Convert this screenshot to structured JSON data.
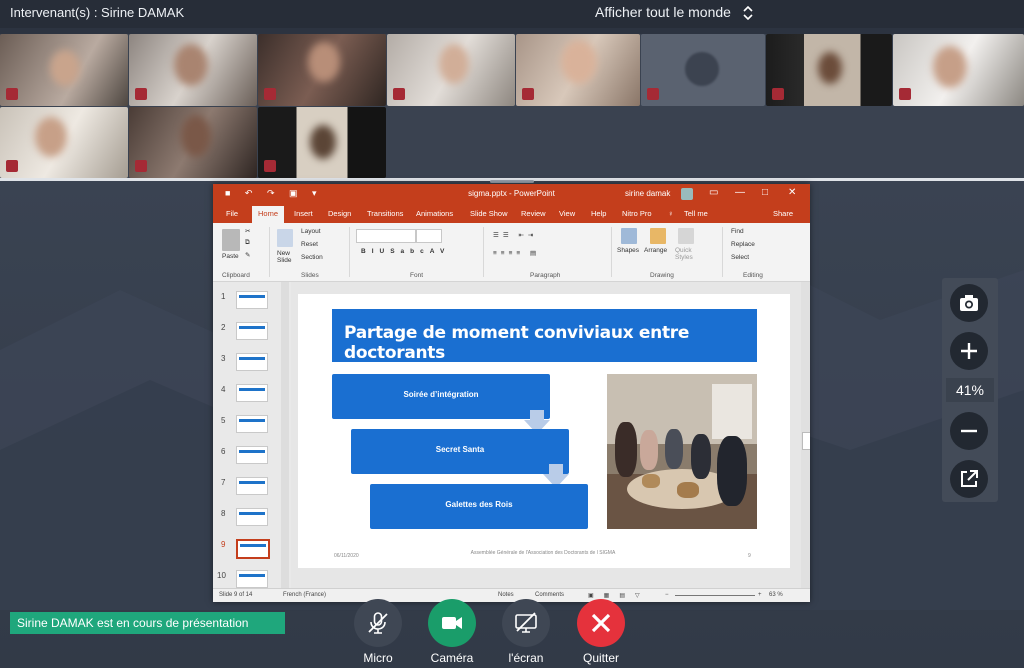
{
  "header": {
    "speaker": "Intervenant(s) : Sirine DAMAK",
    "show_all": "Afficher tout le monde"
  },
  "powerpoint": {
    "window_title": "sigma.pptx - PowerPoint",
    "user": "sirine damak",
    "tabs": [
      "File",
      "Home",
      "Insert",
      "Design",
      "Transitions",
      "Animations",
      "Slide Show",
      "Review",
      "View",
      "Help",
      "Nitro Pro",
      "Tell me",
      "Share"
    ],
    "ribbon": {
      "clipboard": "Clipboard",
      "paste": "Paste",
      "new_slide": "New Slide",
      "layout": "Layout",
      "reset": "Reset",
      "section": "Section",
      "slides": "Slides",
      "font": "Font",
      "paragraph": "Paragraph",
      "shapes": "Shapes",
      "arrange": "Arrange",
      "quick_styles": "Quick Styles",
      "drawing": "Drawing",
      "find": "Find",
      "replace": "Replace",
      "select": "Select",
      "editing": "Editing"
    },
    "thumbnails": [
      "1",
      "2",
      "3",
      "4",
      "5",
      "6",
      "7",
      "8",
      "9",
      "10"
    ],
    "selected_slide": "9",
    "slide": {
      "title": "Partage de moment conviviaux entre doctorants",
      "steps": [
        "Soirée d’intégration",
        "Secret Santa",
        "Galettes des Rois"
      ],
      "footer_date": "06/11/2020",
      "footer_text": "Assemblée Générale de l'Association des Doctorants de l SIGMA",
      "footer_page": "9"
    },
    "status": {
      "slide_count": "Slide 9 of 14",
      "language": "French (France)",
      "notes": "Notes",
      "comments": "Comments",
      "zoom": "63 %"
    }
  },
  "zoom_panel": {
    "value": "41%"
  },
  "toast": "Sirine DAMAK est en cours de présentation",
  "controls": {
    "micro": "Micro",
    "camera": "Caméra",
    "screen": "l'écran",
    "quit": "Quitter"
  },
  "colors": {
    "accent_green": "#1fa77c",
    "quit_red": "#e5323c",
    "camera_green": "#1a9d6a",
    "ppt_red": "#c43e1c",
    "slide_blue": "#1a6fd1"
  }
}
